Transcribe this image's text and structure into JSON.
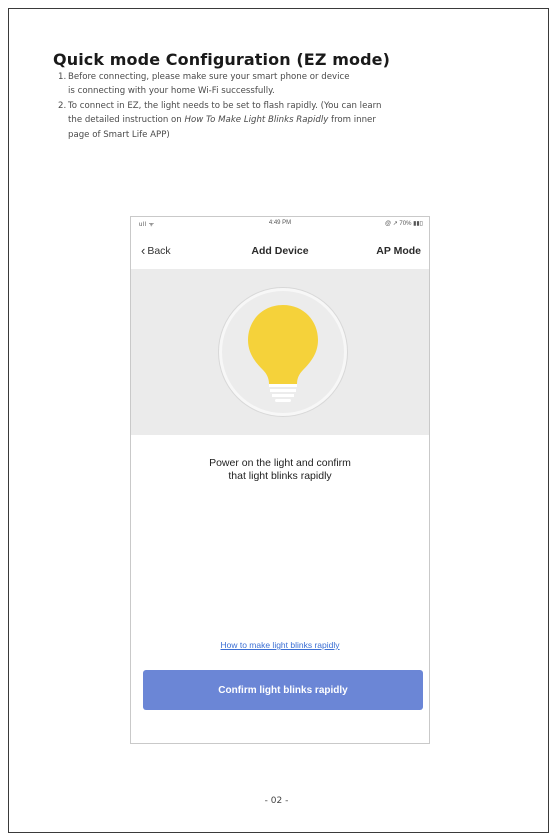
{
  "document": {
    "heading": "Quick mode Configuration (EZ mode)",
    "steps": [
      {
        "number": "1.",
        "line1": "Before connecting, please make sure your smart phone or device",
        "line2": "is connecting with your home Wi-Fi successfully."
      },
      {
        "number": "2.",
        "line1": "To connect in EZ, the light needs to be set to flash rapidly. (You can learn",
        "line2_prefix": "the detailed instruction on ",
        "line2_italic": "How To Make Light Blinks Rapidly",
        "line2_suffix": " from inner",
        "line3": "page of Smart Life APP)"
      }
    ],
    "page_number": "- 02 -"
  },
  "phone": {
    "status": {
      "signal": "ull ᯤ",
      "time": "4:49 PM",
      "battery": "@ ↗ 70% ▮▮▯"
    },
    "nav": {
      "back_label": "Back",
      "title": "Add Device",
      "right_label": "AP Mode"
    },
    "hero": {
      "icon": "light-bulb-icon",
      "bulb_color": "#f5d23a",
      "background": "#ebebeb"
    },
    "instruction_line1": "Power on the light and confirm",
    "instruction_line2": "that light blinks  rapidly",
    "help_link": "How to make light blinks rapidly",
    "confirm_button": "Confirm light blinks rapidly",
    "accent_color": "#6b86d6",
    "link_color": "#3b6fd4"
  }
}
